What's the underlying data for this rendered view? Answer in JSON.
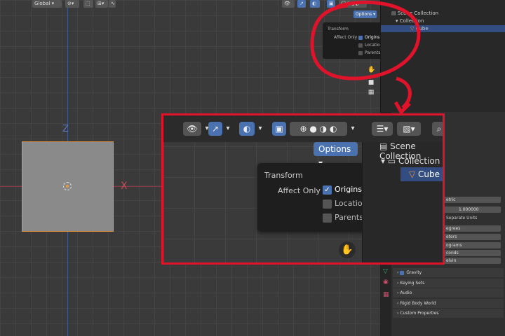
{
  "topbar": {
    "orientation_label": "Global",
    "options_label": "Options"
  },
  "viewport": {
    "axis_z": "Z",
    "axis_x": "X",
    "object_color": "#8a8a8a",
    "selection_color": "#e8953c"
  },
  "options_popup": {
    "title": "Transform",
    "affect_only_label": "Affect Only",
    "items": [
      {
        "label": "Origins",
        "checked": true
      },
      {
        "label": "Locations",
        "checked": false
      },
      {
        "label": "Parents",
        "checked": false
      }
    ]
  },
  "outliner": {
    "scene_collection": "Scene Collection",
    "collection": "Collection",
    "cube": "Cube"
  },
  "properties": {
    "unit_system": "etric",
    "unit_scale": "1.000000",
    "separate_units": "Separate Units",
    "rotation": "egrees",
    "length": "eters",
    "mass": "ograms",
    "time": "conds",
    "temperature": "elvin",
    "sections": [
      "Gravity",
      "Keying Sets",
      "Audio",
      "Rigid Body World",
      "Custom Properties"
    ]
  },
  "colors": {
    "annotation_red": "#e0132a",
    "accent_blue": "#4a72b0"
  }
}
